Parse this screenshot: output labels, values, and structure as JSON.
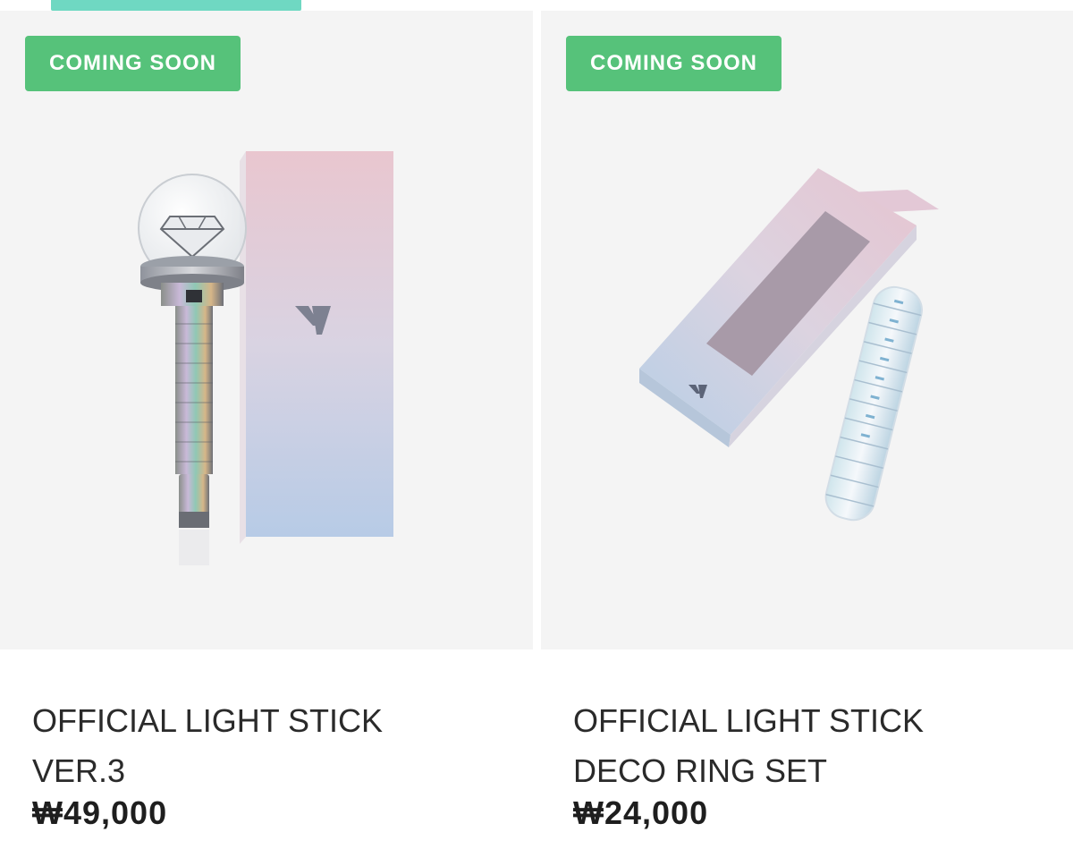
{
  "products": [
    {
      "badge": "COMING SOON",
      "title_line1": "OFFICIAL LIGHT STICK",
      "title_line2": "VER.3",
      "price": "₩49,000",
      "image_icon": "light-stick-with-box"
    },
    {
      "badge": "COMING SOON",
      "title_line1": "OFFICIAL LIGHT STICK",
      "title_line2": "DECO RING SET",
      "price": "₩24,000",
      "image_icon": "deco-ring-set-with-box"
    }
  ],
  "colors": {
    "tab_indicator": "#6fd8c2",
    "badge_bg": "#56c27a",
    "image_bg": "#f4f4f4"
  }
}
